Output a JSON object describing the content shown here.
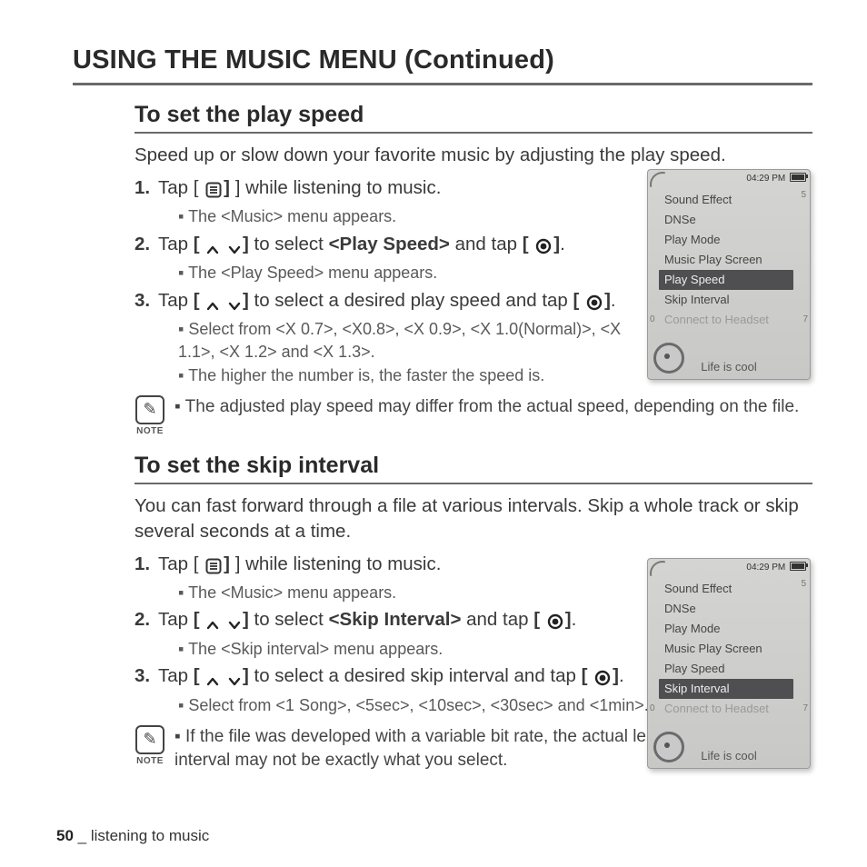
{
  "page_title": "USING THE MUSIC MENU (Continued)",
  "footer": {
    "page_no": "50",
    "sep": " _ ",
    "section": "listening to music"
  },
  "section1": {
    "heading": "To set the play speed",
    "intro": "Speed up or slow down your favorite music by adjusting the play speed.",
    "step1_a": "Tap [",
    "step1_b": "] while listening to music.",
    "step1_sub": "The <Music> menu appears.",
    "step2_a": "Tap ",
    "step2_b": " to select ",
    "step2_item": "<Play Speed>",
    "step2_c": " and tap ",
    "step2_sub": "The <Play Speed> menu appears.",
    "step3_a": "Tap ",
    "step3_b": " to select a desired play speed and tap ",
    "step3_sub1": "Select from <X 0.7>, <X0.8>, <X 0.9>, <X 1.0(Normal)>, <X 1.1>, <X 1.2> and <X 1.3>.",
    "step3_sub2": "The higher the number is, the faster the speed is.",
    "note_label": "NOTE",
    "note": "The adjusted play speed may differ from the actual speed, depending on the file."
  },
  "section2": {
    "heading": "To set the skip interval",
    "intro": "You can fast forward through a file at various intervals. Skip a whole track or skip several seconds at a time.",
    "step1_a": "Tap [",
    "step1_b": "] while listening to music.",
    "step1_sub": "The <Music> menu appears.",
    "step2_a": "Tap ",
    "step2_b": " to select ",
    "step2_item": "<Skip Interval>",
    "step2_c": " and tap ",
    "step2_sub": "The <Skip interval> menu appears.",
    "step3_a": "Tap ",
    "step3_b": " to select a desired skip interval and tap ",
    "step3_sub1": "Select from <1 Song>, <5sec>, <10sec>, <30sec> and <1min>.",
    "note_label": "NOTE",
    "note": "If the file was developed with a variable bit rate, the actual length of the skip interval may not be exactly what you select."
  },
  "device": {
    "clock": "04:29 PM",
    "menu": [
      "Sound Effect",
      "DNSe",
      "Play Mode",
      "Music Play Screen",
      "Play Speed",
      "Skip Interval",
      "Connect to Headset"
    ],
    "now_playing": "Life is cool",
    "highlight1": "Play Speed",
    "highlight2": "Skip Interval"
  },
  "icons": {
    "menu_btn_aria": "menu button icon",
    "updown_aria": "up/down arrows",
    "select_aria": "select/OK button"
  }
}
